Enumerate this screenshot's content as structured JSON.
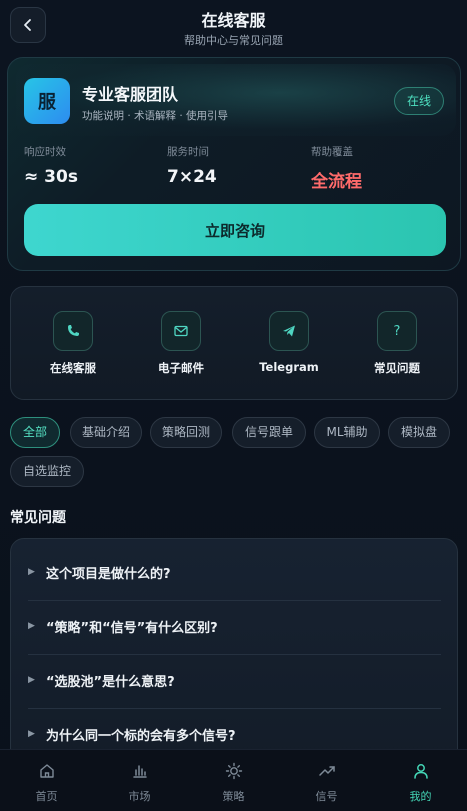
{
  "header": {
    "title": "在线客服",
    "subtitle": "帮助中心与常见问题",
    "back_icon": "chevron-left-icon"
  },
  "team": {
    "logo_text": "服",
    "name": "专业客服团队",
    "tags": "功能说明 · 术语解释 · 使用引导",
    "status": "在线",
    "stats": [
      {
        "label": "响应时效",
        "value": "≈ 30s"
      },
      {
        "label": "服务时间",
        "value": "7×24"
      },
      {
        "label": "帮助覆盖",
        "value": "全流程"
      }
    ],
    "consult_label": "立即咨询"
  },
  "contacts": [
    {
      "label": "在线客服",
      "icon": "phone-icon"
    },
    {
      "label": "电子邮件",
      "icon": "mail-icon"
    },
    {
      "label": "Telegram",
      "icon": "telegram-icon"
    },
    {
      "label": "常见问题",
      "icon": "question-icon"
    }
  ],
  "chips": [
    "全部",
    "基础介绍",
    "策略回测",
    "信号跟单",
    "ML辅助",
    "模拟盘",
    "自选监控"
  ],
  "active_chip": "全部",
  "faq": {
    "heading": "常见问题",
    "items": [
      "这个项目是做什么的?",
      "“策略”和“信号”有什么区别?",
      "“选股池”是什么意思?",
      "为什么同一个标的会有多个信号?"
    ]
  },
  "nav": {
    "items": [
      {
        "label": "首页",
        "icon": "home-icon"
      },
      {
        "label": "市场",
        "icon": "bar-chart-icon"
      },
      {
        "label": "策略",
        "icon": "sun-icon"
      },
      {
        "label": "信号",
        "icon": "trend-icon"
      },
      {
        "label": "我的",
        "icon": "user-icon"
      }
    ],
    "active": "我的"
  },
  "colors": {
    "accent": "#3ed6cf",
    "status_online": "#4ee0c0",
    "highlight_red": "#ff6b6b",
    "background": "#0a111c"
  }
}
